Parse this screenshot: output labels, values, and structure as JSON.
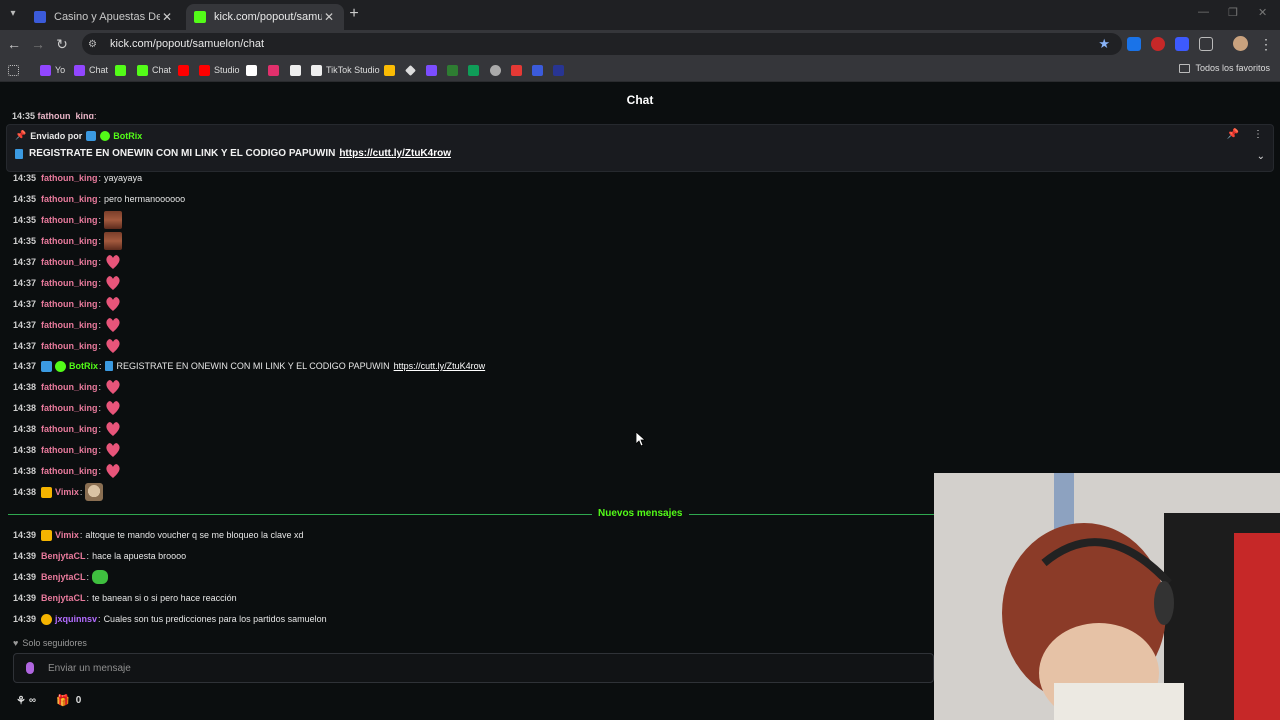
{
  "browser": {
    "tabs": [
      {
        "title": "Casino y Apuestas Deportivas C",
        "active": false,
        "favicon_color": "#3b5bdb"
      },
      {
        "title": "kick.com/popout/samuelon/ch",
        "active": true,
        "favicon_color": "#53fc18"
      }
    ],
    "url": "kick.com/popout/samuelon/chat",
    "bookmarks": [
      {
        "label": "Yo",
        "icon": "twitch-icon",
        "color": "#9146ff"
      },
      {
        "label": "Chat",
        "icon": "twitch-icon",
        "color": "#9146ff"
      },
      {
        "label": "",
        "icon": "kick-icon",
        "color": "#53fc18"
      },
      {
        "label": "Chat",
        "icon": "kick-icon",
        "color": "#53fc18"
      },
      {
        "label": "",
        "icon": "youtube-icon",
        "color": "#ff0000"
      },
      {
        "label": "Studio",
        "icon": "youtube-studio-icon",
        "color": "#ff0000"
      },
      {
        "label": "",
        "icon": "x-icon",
        "color": "#ffffff"
      },
      {
        "label": "",
        "icon": "instagram-icon",
        "color": "#e1306c"
      },
      {
        "label": "",
        "icon": "tiktok-icon",
        "color": "#ffffff"
      },
      {
        "label": "TikTok Studio",
        "icon": "tiktok-icon",
        "color": "#ffffff"
      }
    ],
    "all_bookmarks_label": "Todos los favoritos"
  },
  "chat": {
    "header": "Chat",
    "cut_row": {
      "user": "fathoun_king",
      "sep": ":"
    },
    "pinned": {
      "label": "Enviado por",
      "user": "BotRix",
      "message": "REGISTRATE EN ONEWIN CON MI LINK Y EL CODIGO PAPUWIN",
      "link": "https://cutt.ly/ZtuK4row"
    },
    "messages": [
      {
        "time": "14:35",
        "user": "fathoun_king",
        "color": "#e87a9c",
        "text": "yayayaya",
        "emote": ""
      },
      {
        "time": "14:35",
        "user": "fathoun_king",
        "color": "#e87a9c",
        "text": "pero hermanoooooo",
        "emote": ""
      },
      {
        "time": "14:35",
        "user": "fathoun_king",
        "color": "#e87a9c",
        "text": "",
        "emote": "face"
      },
      {
        "time": "14:35",
        "user": "fathoun_king",
        "color": "#e87a9c",
        "text": "",
        "emote": "face"
      },
      {
        "time": "14:37",
        "user": "fathoun_king",
        "color": "#e87a9c",
        "text": "",
        "emote": "heart"
      },
      {
        "time": "14:37",
        "user": "fathoun_king",
        "color": "#e87a9c",
        "text": "",
        "emote": "heart"
      },
      {
        "time": "14:37",
        "user": "fathoun_king",
        "color": "#e87a9c",
        "text": "",
        "emote": "heart"
      },
      {
        "time": "14:37",
        "user": "fathoun_king",
        "color": "#e87a9c",
        "text": "",
        "emote": "heart"
      },
      {
        "time": "14:37",
        "user": "fathoun_king",
        "color": "#e87a9c",
        "text": "",
        "emote": "heart"
      }
    ],
    "bot_message": {
      "time": "14:37",
      "user": "BotRix",
      "color": "#53fc18",
      "text": "REGISTRATE EN ONEWIN CON MI LINK Y EL CODIGO PAPUWIN",
      "link": "https://cutt.ly/ZtuK4row"
    },
    "messages2": [
      {
        "time": "14:38",
        "user": "fathoun_king",
        "color": "#e87a9c",
        "text": "",
        "emote": "heart"
      },
      {
        "time": "14:38",
        "user": "fathoun_king",
        "color": "#e87a9c",
        "text": "",
        "emote": "heart"
      },
      {
        "time": "14:38",
        "user": "fathoun_king",
        "color": "#e87a9c",
        "text": "",
        "emote": "heart"
      },
      {
        "time": "14:38",
        "user": "fathoun_king",
        "color": "#e87a9c",
        "text": "",
        "emote": "heart"
      },
      {
        "time": "14:38",
        "user": "fathoun_king",
        "color": "#e87a9c",
        "text": "",
        "emote": "heart"
      },
      {
        "time": "14:38",
        "user": "Vimix",
        "color": "#e87a9c",
        "text": "",
        "emote": "cat",
        "badge": "crown"
      }
    ],
    "new_messages_label": "Nuevos mensajes",
    "messages3": [
      {
        "time": "14:39",
        "user": "Vimix",
        "color": "#e87a9c",
        "text": "altoque te mando voucher q se me bloqueo la clave xd",
        "badge": "crown"
      },
      {
        "time": "14:39",
        "user": "BenjytaCL",
        "color": "#e87a9c",
        "text": "hace la apuesta broooo"
      },
      {
        "time": "14:39",
        "user": "BenjytaCL",
        "color": "#e87a9c",
        "text": "",
        "emote": "green"
      },
      {
        "time": "14:39",
        "user": "BenjytaCL",
        "color": "#e87a9c",
        "text": "te banean si o si pero hace reacción"
      },
      {
        "time": "14:39",
        "user": "jxquinnsv",
        "color": "#b36cff",
        "text": "Cuales son tus predicciones para los partidos samuelon",
        "badge": "coin"
      }
    ],
    "followers_only": "Solo seguidores",
    "input_placeholder": "Enviar un mensaje",
    "points_value": "∞",
    "gift_count": "0"
  },
  "colors": {
    "kick_green": "#53fc18",
    "username_pink": "#e87a9c",
    "background": "#0b0e0f"
  }
}
